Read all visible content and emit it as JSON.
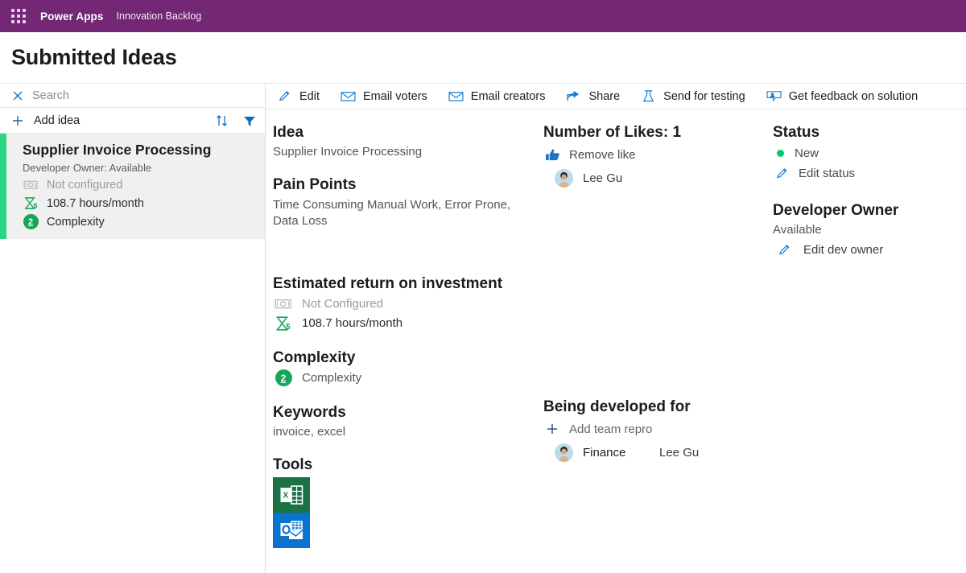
{
  "topbar": {
    "waffle_icon": "waffle-grid-icon",
    "brand": "Power Apps",
    "app_name": "Innovation Backlog"
  },
  "page": {
    "title": "Submitted Ideas"
  },
  "sidebar": {
    "search": {
      "icon": "close-icon",
      "placeholder": "Search",
      "value": ""
    },
    "add": {
      "icon": "plus-icon",
      "label": "Add idea"
    },
    "sort_icon": "sort-ascending-descending-icon",
    "filter_icon": "filter-funnel-icon",
    "accent_color": "#2BD680",
    "items": [
      {
        "title": "Supplier Invoice Processing",
        "subtitle": "Developer Owner: Available",
        "roi_icon": "money-banknote-icon",
        "roi_text": "Not configured",
        "hours_icon": "hourglass-dollar-icon",
        "hours_text": "108.7 hours/month",
        "complexity_badge": "2",
        "complexity_text": "Complexity"
      }
    ]
  },
  "commandbar": {
    "commands": [
      {
        "icon": "pencil-icon",
        "label": "Edit"
      },
      {
        "icon": "envelope-icon",
        "label": "Email voters"
      },
      {
        "icon": "envelope-icon",
        "label": "Email creators"
      },
      {
        "icon": "share-icon",
        "label": "Share"
      },
      {
        "icon": "flask-icon",
        "label": "Send for testing"
      },
      {
        "icon": "feedback-person-icon",
        "label": "Get feedback on solution"
      }
    ]
  },
  "details": {
    "idea": {
      "heading": "Idea",
      "value": "Supplier Invoice Processing"
    },
    "pain_points": {
      "heading": "Pain Points",
      "value": "Time Consuming Manual Work, Error Prone, Data Loss"
    },
    "roi": {
      "heading": "Estimated return on investment",
      "money_icon": "money-banknote-icon",
      "money_value": "Not Configured",
      "hours_icon": "hourglass-dollar-icon",
      "hours_value": "108.7 hours/month"
    },
    "complexity": {
      "heading": "Complexity",
      "badge": "2",
      "value": "Complexity"
    },
    "keywords": {
      "heading": "Keywords",
      "value": "invoice, excel"
    },
    "tools": {
      "heading": "Tools",
      "items": [
        {
          "icon": "excel-icon",
          "name": "Excel",
          "color": "#1B7243"
        },
        {
          "icon": "outlook-icon",
          "name": "Outlook",
          "color": "#0A73D0"
        }
      ]
    }
  },
  "likes": {
    "heading": "Number of Likes: 1",
    "count": "1",
    "action": {
      "icon": "thumbs-up-icon",
      "label": "Remove like"
    },
    "voters": [
      {
        "avatar": "person-avatar",
        "name": "Lee Gu"
      }
    ]
  },
  "developed_for": {
    "heading": "Being developed for",
    "add": {
      "icon": "plus-icon",
      "label": "Add team repro"
    },
    "rows": [
      {
        "avatar": "person-avatar",
        "team": "Finance",
        "person": "Lee Gu"
      }
    ]
  },
  "status": {
    "heading": "Status",
    "dot_color": "#00CC6A",
    "value": "New",
    "edit": {
      "icon": "pencil-icon",
      "label": "Edit status"
    }
  },
  "dev_owner": {
    "heading": "Developer Owner",
    "value": "Available",
    "edit": {
      "icon": "pencil-icon",
      "label": "Edit dev owner"
    }
  }
}
